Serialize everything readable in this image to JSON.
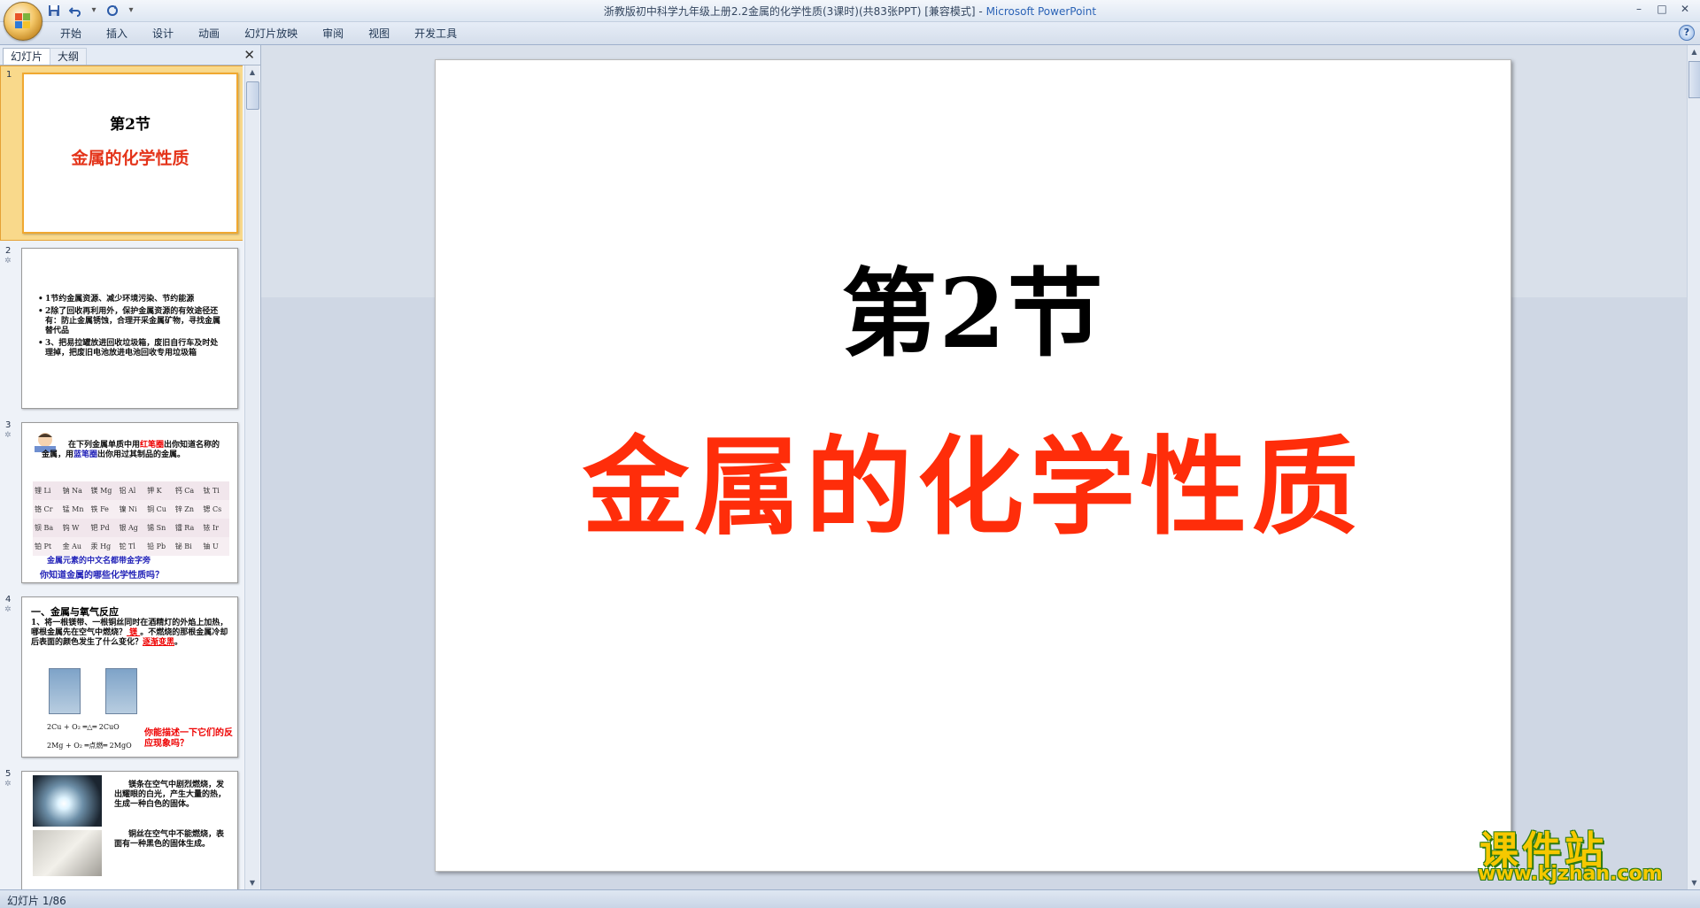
{
  "window": {
    "title": "浙教版初中科学九年级上册2.2金属的化学性质(3课时)(共83张PPT)  [兼容模式]",
    "title_sep": " - ",
    "app_name": "Microsoft PowerPoint",
    "controls": {
      "minimize": "–",
      "maximize": "□",
      "close": "✕"
    }
  },
  "quick_access": {
    "save_icon": "save-icon",
    "undo_icon": "undo-icon",
    "redo_icon": "redo-icon",
    "customize_icon": "customize-icon"
  },
  "ribbon": {
    "tabs": [
      "开始",
      "插入",
      "设计",
      "动画",
      "幻灯片放映",
      "审阅",
      "视图",
      "开发工具"
    ],
    "help_label": "?"
  },
  "left_panel": {
    "tab_slides": "幻灯片",
    "tab_outline": "大纲",
    "close_label": "✕",
    "slides": [
      {
        "number": "1",
        "section": "第2节",
        "title": "金属的化学性质"
      },
      {
        "number": "2",
        "bullets": [
          "1节约金属资源、减少环境污染、节约能源",
          "2除了回收再利用外，保护金属资源的有效途径还有：防止金属锈蚀，合理开采金属矿物，寻找金属替代品",
          "3、把易拉罐放进回收垃圾箱，废旧自行车及时处理掉，把废旧电池放进电池回收专用垃圾箱"
        ]
      },
      {
        "number": "3",
        "intro_1": "在下列金属单质中用",
        "intro_red": "红笔圈",
        "intro_2": "出你知道名称的金属，用",
        "intro_blue": "蓝笔圈",
        "intro_3": "出你用过其制品的金属。",
        "grid": [
          [
            "锂 Li",
            "钠 Na",
            "镁 Mg",
            "铝 Al",
            "钾 K",
            "钙 Ca",
            "钛 Ti"
          ],
          [
            "铬 Cr",
            "锰 Mn",
            "铁 Fe",
            "镍 Ni",
            "铜 Cu",
            "锌 Zn",
            "锶 Cs"
          ],
          [
            "钡 Ba",
            "钨 W",
            "钯 Pd",
            "银 Ag",
            "锡 Sn",
            "镭 Ra",
            "铱 Ir"
          ],
          [
            "铂 Pt",
            "金 Au",
            "汞 Hg",
            "铊 Tl",
            "铅 Pb",
            "铋 Bi",
            "铀 U"
          ]
        ],
        "note1": "金属元素的中文名都带金字旁",
        "note2": "你知道金属的哪些化学性质吗？"
      },
      {
        "number": "4",
        "heading": "一、金属与氧气反应",
        "question_1": "1、将一根镁带、一根铜丝同时在酒精灯的外焰上加热，哪根金属先在空气中燃烧？",
        "answer_1": "  镁  ",
        "question_2": "。不燃烧的那根金属冷却后表面的颜色发生了什么变化？",
        "answer_2": "逐渐变黑",
        "question_end": "。",
        "eq1": "2Cu + O₂ ═△═ 2CuO",
        "eq2": "2Mg + O₂ ═点燃═ 2MgO",
        "ask": "你能描述一下它们的反应现象吗？"
      },
      {
        "number": "5",
        "text1": "镁条在空气中剧烈燃烧，发出耀眼的白光，产生大量的热，生成一种白色的固体。",
        "text2": "铜丝在空气中不能燃烧，表面有一种黑色的固体生成。"
      }
    ]
  },
  "slide": {
    "section": "第2节",
    "title": "金属的化学性质"
  },
  "status": {
    "slide_info": "幻灯片 1/86"
  },
  "watermark": {
    "cn": "课件站",
    "url": "www.kjzhan.com"
  },
  "colors": {
    "title_red": "#ff2d0a",
    "selection": "#f9d98b",
    "accent_blue": "#2b63b6"
  }
}
